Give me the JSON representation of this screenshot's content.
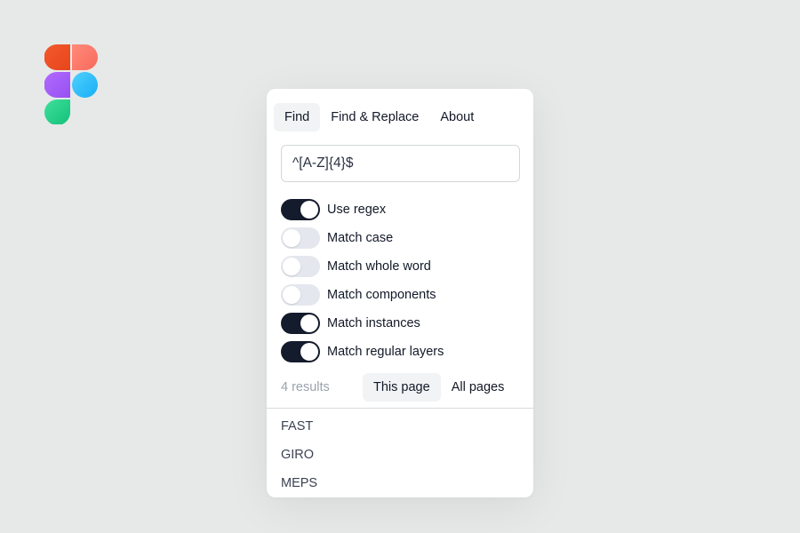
{
  "logo": {
    "icon": "figma-logo-icon",
    "colors": [
      "#f24e1e",
      "#ff7262",
      "#a259ff",
      "#1abcfe",
      "#0acf83"
    ]
  },
  "tabs": [
    {
      "label": "Find",
      "active": true
    },
    {
      "label": "Find & Replace",
      "active": false
    },
    {
      "label": "About",
      "active": false
    }
  ],
  "search": {
    "value": "^[A-Z]{4}$",
    "placeholder": ""
  },
  "options": [
    {
      "label": "Use regex",
      "on": true
    },
    {
      "label": "Match case",
      "on": false
    },
    {
      "label": "Match whole word",
      "on": false
    },
    {
      "label": "Match components",
      "on": false
    },
    {
      "label": "Match instances",
      "on": true
    },
    {
      "label": "Match regular layers",
      "on": true
    }
  ],
  "scope": {
    "results_count": "4 results",
    "tabs": [
      {
        "label": "This page",
        "active": true
      },
      {
        "label": "All pages",
        "active": false
      }
    ]
  },
  "results": [
    "FAST",
    "GIRO",
    "MEPS"
  ],
  "colors": {
    "toggle_on": "#141b2d",
    "toggle_off": "#e4e8ee",
    "background": "#e6e9e8"
  }
}
